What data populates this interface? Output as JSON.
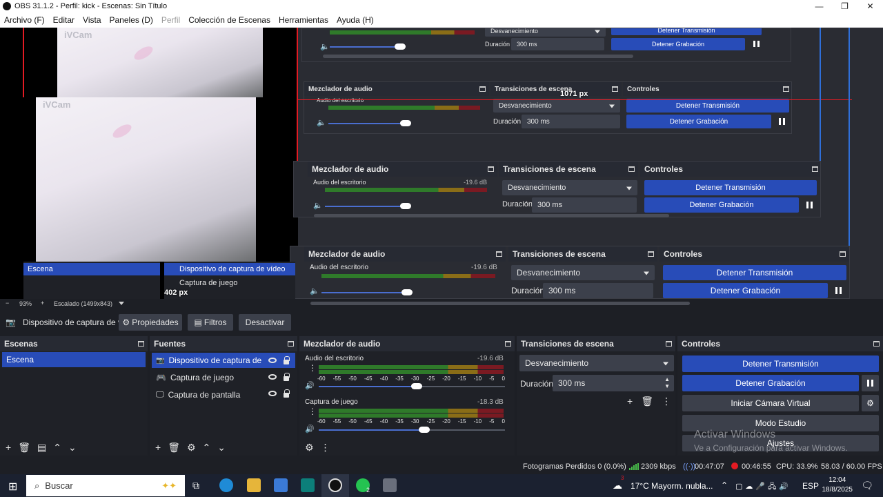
{
  "window": {
    "title": "OBS 31.1.2 - Perfil: kick - Escenas: Sin Título",
    "controls": [
      "—",
      "❐",
      "✕"
    ]
  },
  "menu": [
    "Archivo (F)",
    "Editar",
    "Vista",
    "Paneles (D)",
    "Perfil",
    "Colección de Escenas",
    "Herramientas",
    "Ayuda (H)"
  ],
  "preview": {
    "cam_label": "iVCam",
    "measure_width": "1071 px",
    "measure_height": "402 px",
    "zoom_percent": "93%",
    "scale_label": "Escalado (1499x843)"
  },
  "mirror": {
    "scene_item": "Escena",
    "source_items": [
      "Dispositivo de captura de vídeo",
      "Captura de juego",
      "Captura de pantalla"
    ]
  },
  "context": {
    "source_name": "Dispositivo de captura de v",
    "properties": "Propiedades",
    "filters": "Filtros",
    "deactivate": "Desactivar"
  },
  "docks": {
    "scenes": {
      "title": "Escenas",
      "items": [
        "Escena"
      ]
    },
    "sources": {
      "title": "Fuentes",
      "items": [
        "Dispositivo de captura de vídeo",
        "Captura de juego",
        "Captura de pantalla"
      ]
    },
    "mixer": {
      "title": "Mezclador de audio",
      "channels": [
        {
          "name": "Audio del escritorio",
          "db": "-19.6 dB",
          "level": 0.52
        },
        {
          "name": "Captura de juego",
          "db": "-18.3 dB",
          "level": 0.56
        }
      ],
      "ticks": [
        "-60",
        "-55",
        "-50",
        "-45",
        "-40",
        "-35",
        "-30",
        "-25",
        "-20",
        "-15",
        "-10",
        "-5",
        "0"
      ]
    },
    "transitions": {
      "title": "Transiciones de escena",
      "selected": "Desvanecimiento",
      "duration_label": "Duración",
      "duration_value": "300 ms"
    },
    "controls": {
      "title": "Controles",
      "stop_stream": "Detener Transmisión",
      "stop_record": "Detener Grabación",
      "virtual_cam": "Iniciar Cámara Virtual",
      "studio_mode": "Modo Estudio",
      "settings": "Ajustes"
    }
  },
  "status": {
    "dropped": "Fotogramas Perdidos 0 (0.0%)",
    "bitrate": "2309 kbps",
    "stream_time": "00:47:07",
    "rec_time": "00:46:55",
    "cpu": "CPU: 33.9%",
    "fps": "58.03 / 60.00 FPS"
  },
  "watermark": {
    "line1": "Activar Windows",
    "line2": "Ve a Configuración para activar Windows."
  },
  "taskbar": {
    "search": "Buscar",
    "weather": "17°C  Mayorm. nubla...",
    "lang": "ESP",
    "time": "12:04",
    "date": "18/8/2025",
    "whatsapp_badge": "2",
    "weather_badge": "3"
  },
  "colors": {
    "accent": "#284cb8",
    "record": "#e31b23"
  }
}
